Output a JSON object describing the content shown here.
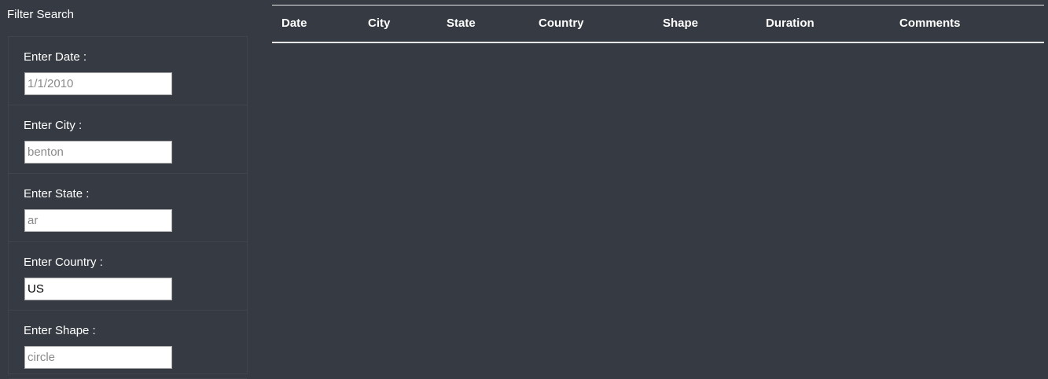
{
  "filter_panel": {
    "title": "Filter Search",
    "filters": [
      {
        "label": "Enter Date :",
        "value": "",
        "placeholder": "1/1/2010"
      },
      {
        "label": "Enter City :",
        "value": "",
        "placeholder": "benton"
      },
      {
        "label": "Enter State :",
        "value": "",
        "placeholder": "ar"
      },
      {
        "label": "Enter Country :",
        "value": "US",
        "placeholder": ""
      },
      {
        "label": "Enter Shape :",
        "value": "",
        "placeholder": "circle"
      }
    ]
  },
  "table": {
    "columns": [
      "Date",
      "City",
      "State",
      "Country",
      "Shape",
      "Duration",
      "Comments"
    ],
    "rows": []
  },
  "colors": {
    "background": "#363a42",
    "text": "#ffffff",
    "divider": "#e6e6e6"
  }
}
